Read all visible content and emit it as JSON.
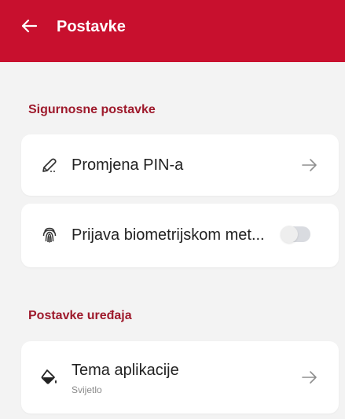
{
  "header": {
    "title": "Postavke",
    "back_icon": "arrow-left-icon",
    "background": "#c8102e"
  },
  "sections": [
    {
      "title": "Sigurnosne postavke",
      "items": [
        {
          "label": "Promjena PIN-a",
          "icon": "pen-icon",
          "action": "arrow-right-icon"
        },
        {
          "label": "Prijava biometrijskom met...",
          "icon": "fingerprint-icon",
          "action": "toggle",
          "toggle_on": false
        }
      ]
    },
    {
      "title": "Postavke uređaja",
      "items": [
        {
          "label": "Tema aplikacije",
          "sublabel": "Svijetlo",
          "icon": "paint-bucket-icon",
          "action": "arrow-right-icon"
        }
      ]
    }
  ],
  "colors": {
    "accent": "#c8102e",
    "section_title": "#9e1a2c",
    "background": "#f3f3f3",
    "card": "#ffffff"
  }
}
